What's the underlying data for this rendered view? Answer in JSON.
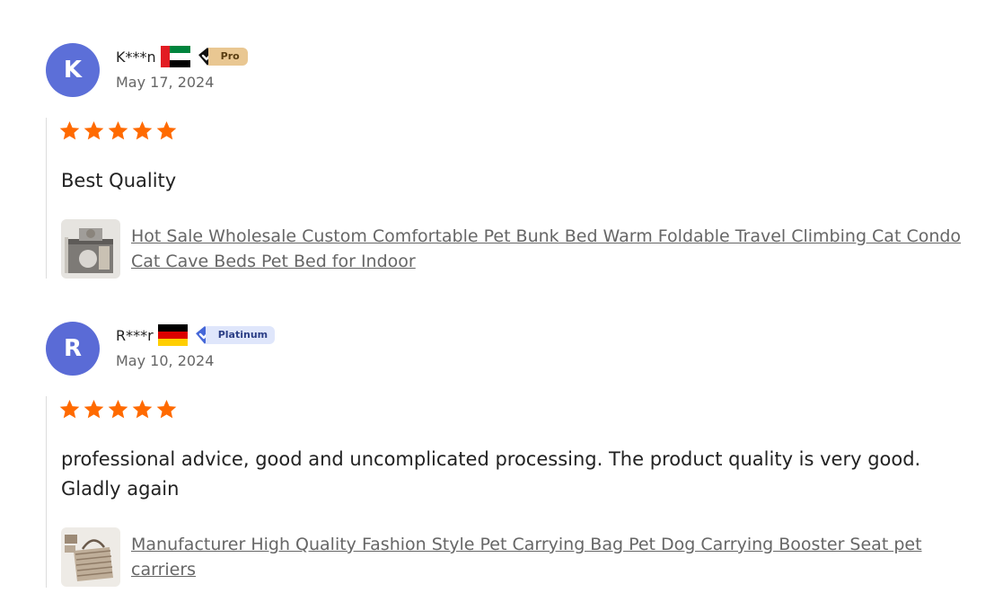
{
  "reviews": [
    {
      "avatar_initial": "K",
      "avatar_color": "#5c6fd8",
      "username": "K***n",
      "country_flag": "uae-flag",
      "badge": {
        "label": "Pro",
        "icon": "black-diamond-check-icon",
        "color": "#e9c792"
      },
      "date": "May 17, 2024",
      "rating": 5,
      "star_color": "#ff6a00",
      "text": "Best Quality",
      "product": {
        "thumbnail": "cat-bunk-bed-thumbnail",
        "title": "Hot Sale Wholesale Custom Comfortable Pet Bunk Bed Warm Foldable Travel Climbing Cat Condo Cat Cave Beds Pet Bed for Indoor"
      }
    },
    {
      "avatar_initial": "R",
      "avatar_color": "#5a6bd6",
      "username": "R***r",
      "country_flag": "germany-flag",
      "badge": {
        "label": "Platinum",
        "icon": "blue-diamond-check-icon",
        "color": "#dfe6fb"
      },
      "date": "May 10, 2024",
      "rating": 5,
      "star_color": "#ff6a00",
      "text": "professional advice, good and uncomplicated processing. The product quality is very good. Gladly again",
      "product": {
        "thumbnail": "pet-carrier-bag-thumbnail",
        "title": "Manufacturer High Quality Fashion Style Pet Carrying Bag Pet Dog Carrying Booster Seat pet carriers"
      }
    }
  ]
}
